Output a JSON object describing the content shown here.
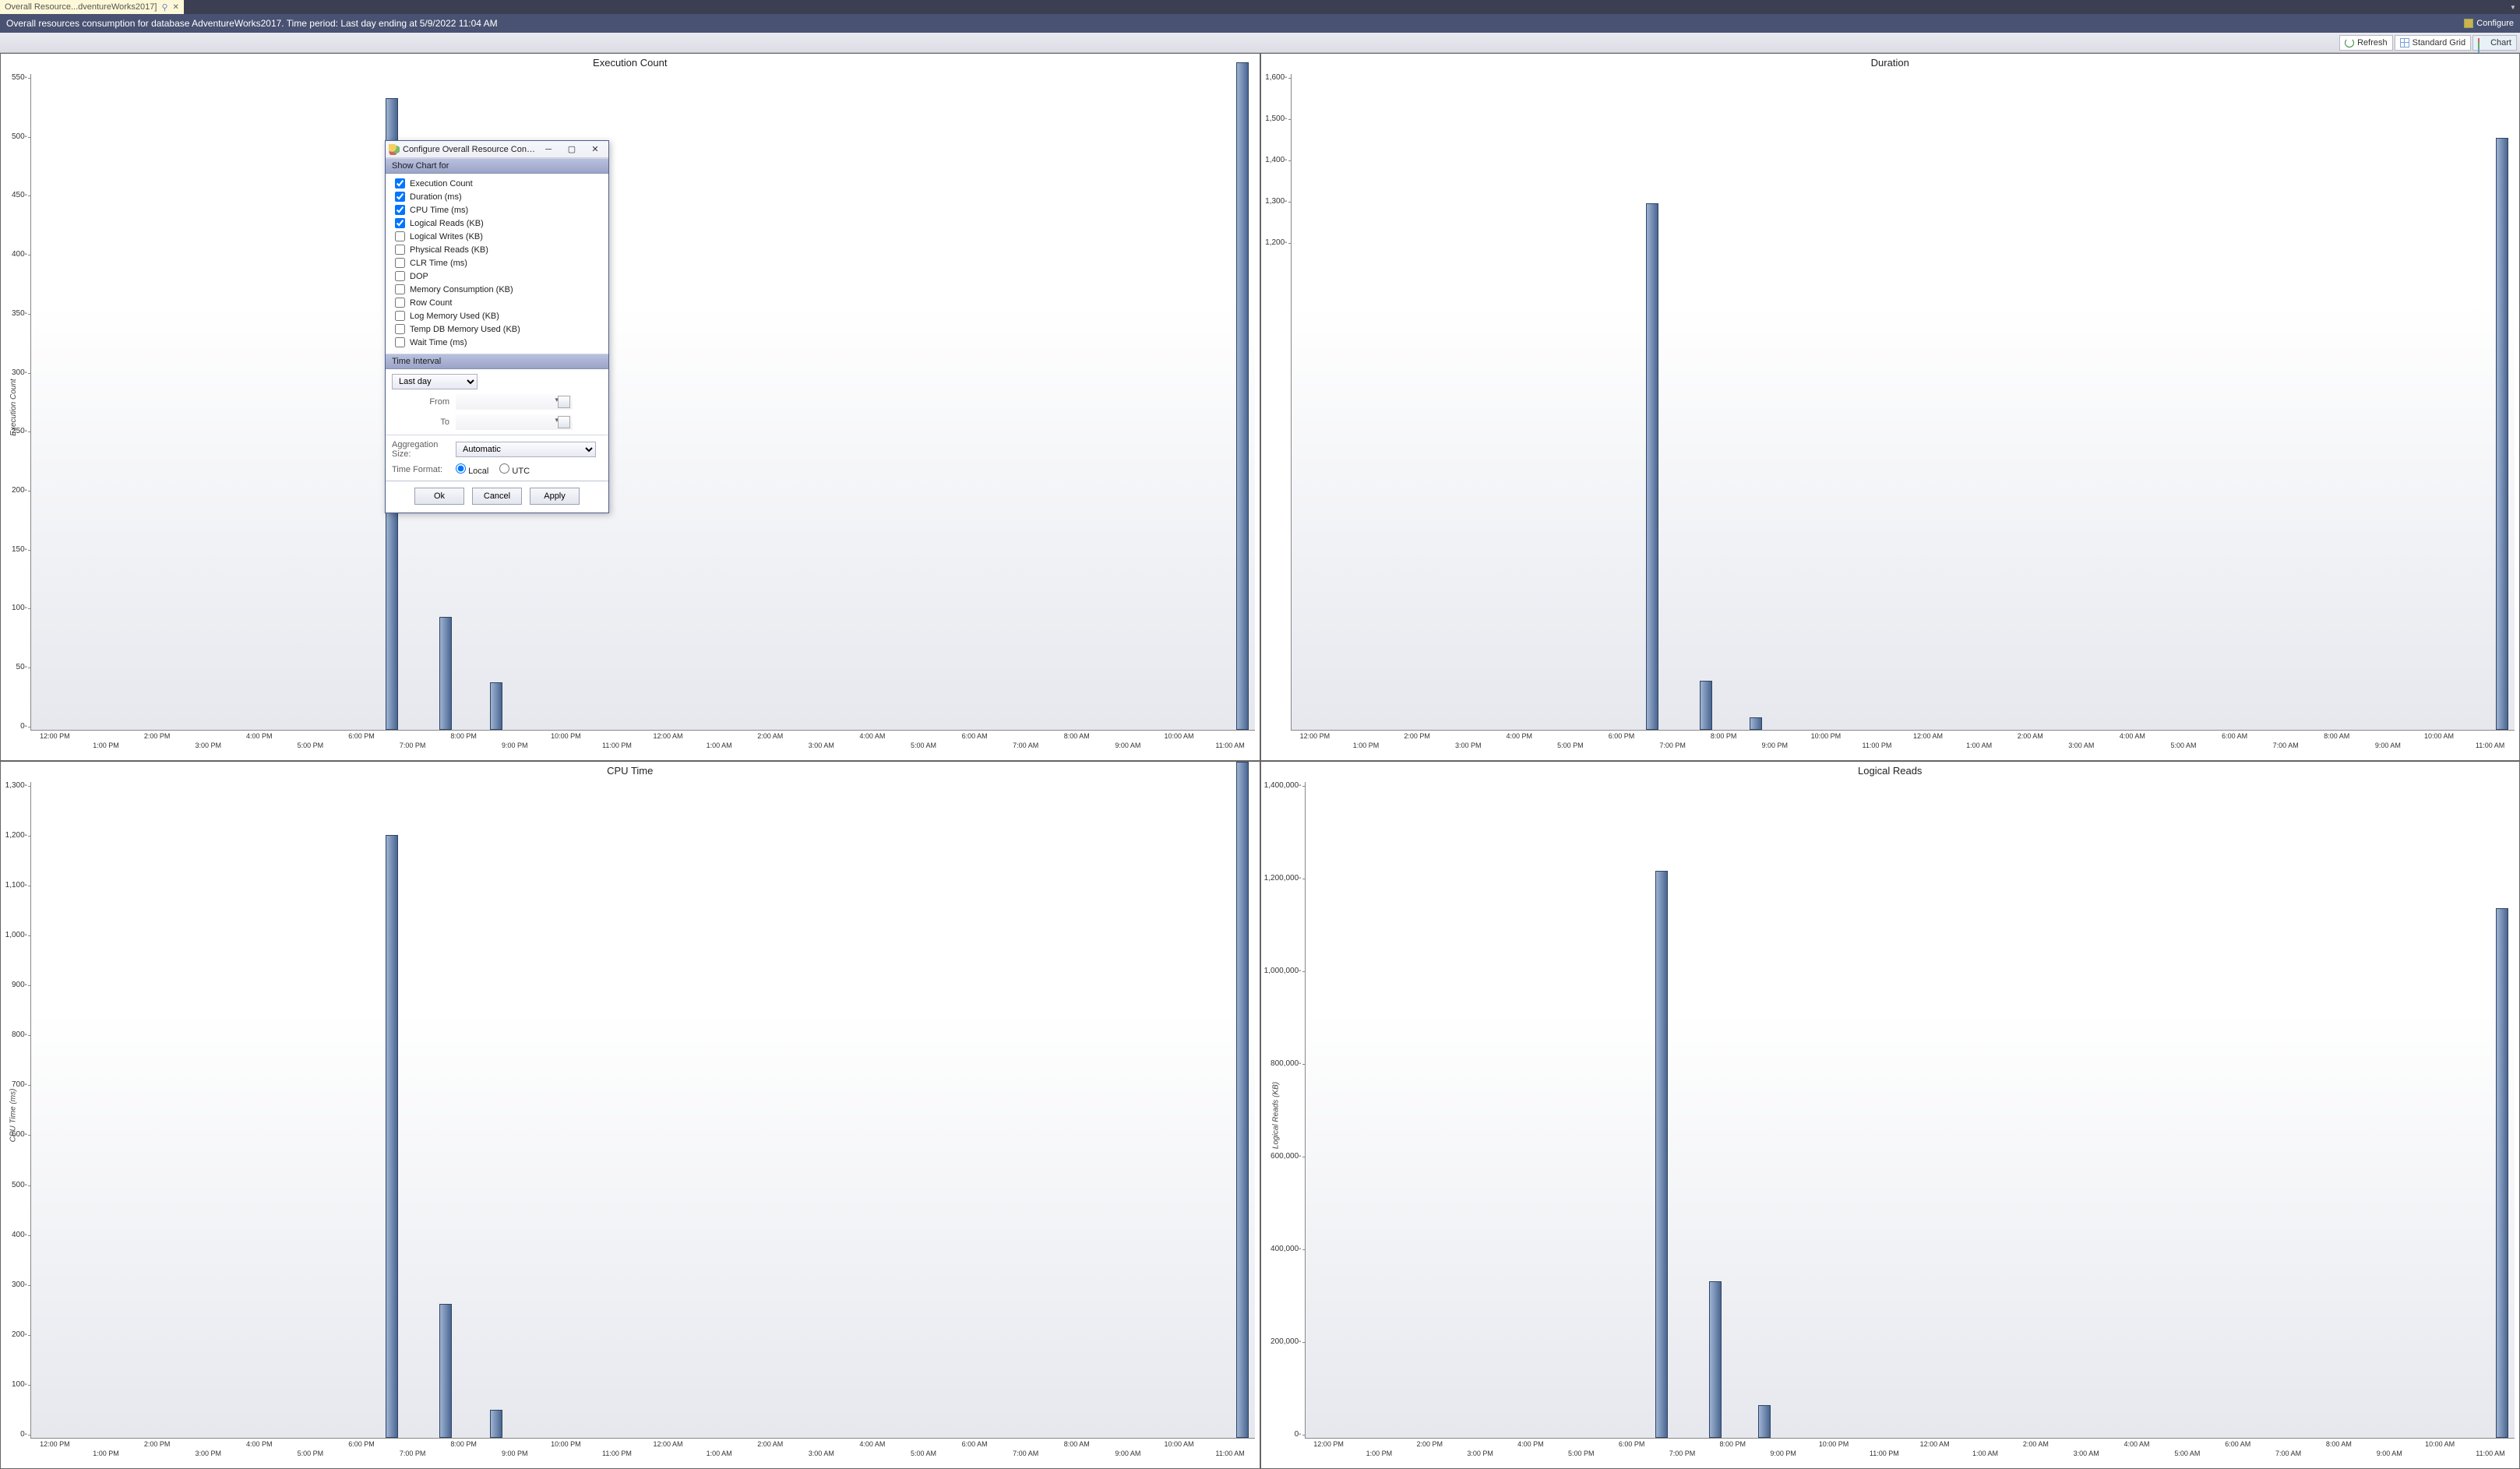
{
  "tab": {
    "label": "Overall Resource...dventureWorks2017]",
    "pinned": true
  },
  "title_bar": {
    "text": "Overall resources consumption for database AdventureWorks2017. Time period: Last day ending at 5/9/2022 11:04 AM",
    "configure_label": "Configure"
  },
  "toolbar": {
    "refresh": "Refresh",
    "standard_grid": "Standard Grid",
    "chart": "Chart"
  },
  "charts": [
    {
      "id": "exec",
      "title": "Execution Count",
      "y_label": "Execution Count"
    },
    {
      "id": "dur",
      "title": "Duration",
      "y_label": ""
    },
    {
      "id": "cpu",
      "title": "CPU Time",
      "y_label": "CPU Time (ms)"
    },
    {
      "id": "log",
      "title": "Logical Reads",
      "y_label": "Logical Reads (KB)"
    }
  ],
  "dialog": {
    "title": "Configure Overall Resource Consumption [Adven...",
    "section_show": "Show Chart for",
    "options": [
      {
        "label": "Execution Count",
        "checked": true
      },
      {
        "label": "Duration (ms)",
        "checked": true
      },
      {
        "label": "CPU Time (ms)",
        "checked": true
      },
      {
        "label": "Logical Reads (KB)",
        "checked": true
      },
      {
        "label": "Logical Writes (KB)",
        "checked": false
      },
      {
        "label": "Physical Reads (KB)",
        "checked": false
      },
      {
        "label": "CLR Time (ms)",
        "checked": false
      },
      {
        "label": "DOP",
        "checked": false
      },
      {
        "label": "Memory Consumption (KB)",
        "checked": false
      },
      {
        "label": "Row Count",
        "checked": false
      },
      {
        "label": "Log Memory Used (KB)",
        "checked": false
      },
      {
        "label": "Temp DB Memory Used (KB)",
        "checked": false
      },
      {
        "label": "Wait Time (ms)",
        "checked": false
      }
    ],
    "section_time": "Time Interval",
    "interval_select": "Last day",
    "from_lbl": "From",
    "to_lbl": "To",
    "agg_lbl": "Aggregation Size:",
    "agg_val": "Automatic",
    "tf_lbl": "Time Format:",
    "tf_local": "Local",
    "tf_utc": "UTC",
    "btn_ok": "Ok",
    "btn_cancel": "Cancel",
    "btn_apply": "Apply"
  },
  "chart_data": [
    {
      "title": "Execution Count",
      "type": "bar",
      "ylabel": "Execution Count",
      "ylim": [
        0,
        550
      ],
      "y_ticks": [
        "550",
        "500",
        "450",
        "400",
        "350",
        "300",
        "250",
        "200",
        "150",
        "100",
        "50",
        "0"
      ],
      "bars": [
        {
          "x_label": "7:00 PM",
          "x_pct": 29.5,
          "value": 530
        },
        {
          "x_label": "8:00 PM",
          "x_pct": 33.9,
          "value": 95
        },
        {
          "x_label": "9:00 PM",
          "x_pct": 38.0,
          "value": 40
        },
        {
          "x_label": "11:00 AM",
          "x_pct": 99.0,
          "value": 560
        }
      ],
      "x_majors": [
        "12:00 PM",
        "2:00 PM",
        "4:00 PM",
        "6:00 PM",
        "8:00 PM",
        "10:00 PM",
        "12:00 AM",
        "2:00 AM",
        "4:00 AM",
        "6:00 AM",
        "8:00 AM",
        "10:00 AM"
      ],
      "x_minors": [
        "1:00 PM",
        "3:00 PM",
        "5:00 PM",
        "7:00 PM",
        "9:00 PM",
        "11:00 PM",
        "1:00 AM",
        "3:00 AM",
        "5:00 AM",
        "7:00 AM",
        "9:00 AM",
        "11:00 AM"
      ]
    },
    {
      "title": "Duration",
      "type": "bar",
      "ylabel": "",
      "ylim": [
        0,
        1600
      ],
      "y_ticks": [
        "1,600",
        "1,500",
        "1,400",
        "1,300",
        "1,200"
      ],
      "bars": [
        {
          "x_label": "7:00 PM",
          "x_pct": 29.5,
          "value": 1285
        },
        {
          "x_label": "8:00 PM",
          "x_pct": 33.9,
          "value": 120
        },
        {
          "x_label": "9:00 PM",
          "x_pct": 38.0,
          "value": 30
        },
        {
          "x_label": "11:00 AM",
          "x_pct": 99.0,
          "value": 1445
        }
      ],
      "x_majors": [
        "12:00 PM",
        "2:00 PM",
        "4:00 PM",
        "6:00 PM",
        "8:00 PM",
        "10:00 PM",
        "12:00 AM",
        "2:00 AM",
        "4:00 AM",
        "6:00 AM",
        "8:00 AM",
        "10:00 AM"
      ],
      "x_minors": [
        "1:00 PM",
        "3:00 PM",
        "5:00 PM",
        "7:00 PM",
        "9:00 PM",
        "11:00 PM",
        "1:00 AM",
        "3:00 AM",
        "5:00 AM",
        "7:00 AM",
        "9:00 AM",
        "11:00 AM"
      ]
    },
    {
      "title": "CPU Time",
      "type": "bar",
      "ylabel": "CPU Time (ms)",
      "ylim": [
        0,
        1300
      ],
      "y_ticks": [
        "1,300",
        "1,200",
        "1,100",
        "1,000",
        "900",
        "800",
        "700",
        "600",
        "500",
        "400",
        "300",
        "200",
        "100",
        "0"
      ],
      "bars": [
        {
          "x_label": "7:00 PM",
          "x_pct": 29.5,
          "value": 1195
        },
        {
          "x_label": "8:00 PM",
          "x_pct": 33.9,
          "value": 265
        },
        {
          "x_label": "9:00 PM",
          "x_pct": 38.0,
          "value": 55
        },
        {
          "x_label": "11:00 AM",
          "x_pct": 99.0,
          "value": 1340
        }
      ],
      "x_majors": [
        "12:00 PM",
        "2:00 PM",
        "4:00 PM",
        "6:00 PM",
        "8:00 PM",
        "10:00 PM",
        "12:00 AM",
        "2:00 AM",
        "4:00 AM",
        "6:00 AM",
        "8:00 AM",
        "10:00 AM"
      ],
      "x_minors": [
        "1:00 PM",
        "3:00 PM",
        "5:00 PM",
        "7:00 PM",
        "9:00 PM",
        "11:00 PM",
        "1:00 AM",
        "3:00 AM",
        "5:00 AM",
        "7:00 AM",
        "9:00 AM",
        "11:00 AM"
      ]
    },
    {
      "title": "Logical Reads",
      "type": "bar",
      "ylabel": "Logical Reads (KB)",
      "ylim": [
        0,
        1400000
      ],
      "y_ticks": [
        "1,400,000",
        "1,200,000",
        "1,000,000",
        "800,000",
        "600,000",
        "400,000",
        "200,000",
        "0"
      ],
      "bars": [
        {
          "x_label": "7:00 PM",
          "x_pct": 29.5,
          "value": 1210000
        },
        {
          "x_label": "8:00 PM",
          "x_pct": 33.9,
          "value": 335000
        },
        {
          "x_label": "9:00 PM",
          "x_pct": 38.0,
          "value": 70000
        },
        {
          "x_label": "11:00 AM",
          "x_pct": 99.0,
          "value": 1130000
        }
      ],
      "x_majors": [
        "12:00 PM",
        "2:00 PM",
        "4:00 PM",
        "6:00 PM",
        "8:00 PM",
        "10:00 PM",
        "12:00 AM",
        "2:00 AM",
        "4:00 AM",
        "6:00 AM",
        "8:00 AM",
        "10:00 AM"
      ],
      "x_minors": [
        "1:00 PM",
        "3:00 PM",
        "5:00 PM",
        "7:00 PM",
        "9:00 PM",
        "11:00 PM",
        "1:00 AM",
        "3:00 AM",
        "5:00 AM",
        "7:00 AM",
        "9:00 AM",
        "11:00 AM"
      ]
    }
  ]
}
